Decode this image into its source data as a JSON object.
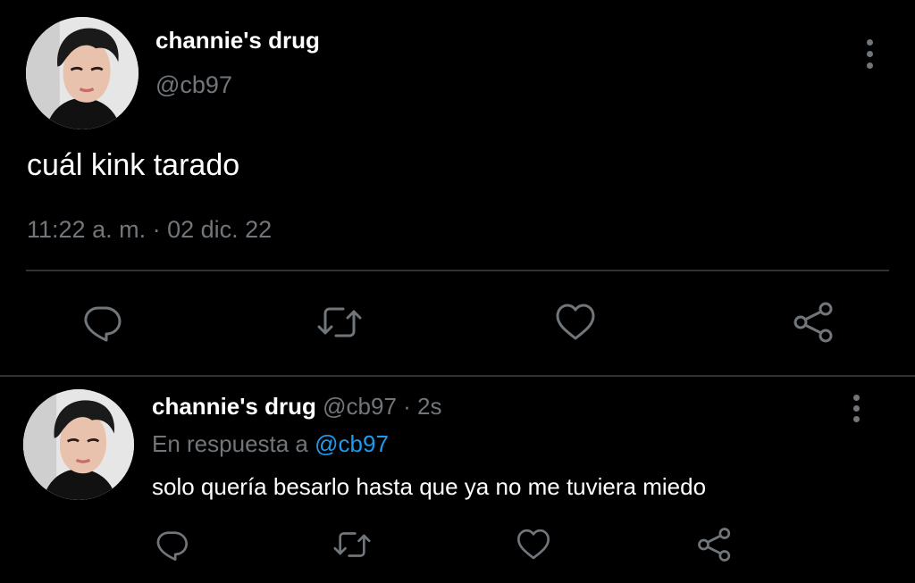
{
  "colors": {
    "background": "#000000",
    "primary_text": "#ffffff",
    "secondary_text": "#71767b",
    "link": "#1d9bf0",
    "divider": "#2f3336"
  },
  "main_tweet": {
    "display_name": "channie's drug",
    "handle": "@cb97",
    "text": "cuál kink tarado",
    "timestamp": "11:22 a. m. · 02 dic. 22",
    "icons": {
      "more": "more-vertical-icon",
      "reply": "reply-icon",
      "retweet": "retweet-icon",
      "like": "heart-icon",
      "share": "share-icon"
    }
  },
  "reply_tweet": {
    "display_name": "channie's drug",
    "handle": "@cb97",
    "separator": "·",
    "time_ago": "2s",
    "replying_to_prefix": "En respuesta a",
    "replying_to_handle": "@cb97",
    "text": "solo quería besarlo hasta que ya no me tuviera miedo",
    "icons": {
      "more": "more-vertical-icon",
      "reply": "reply-icon",
      "retweet": "retweet-icon",
      "like": "heart-icon",
      "share": "share-icon"
    }
  }
}
